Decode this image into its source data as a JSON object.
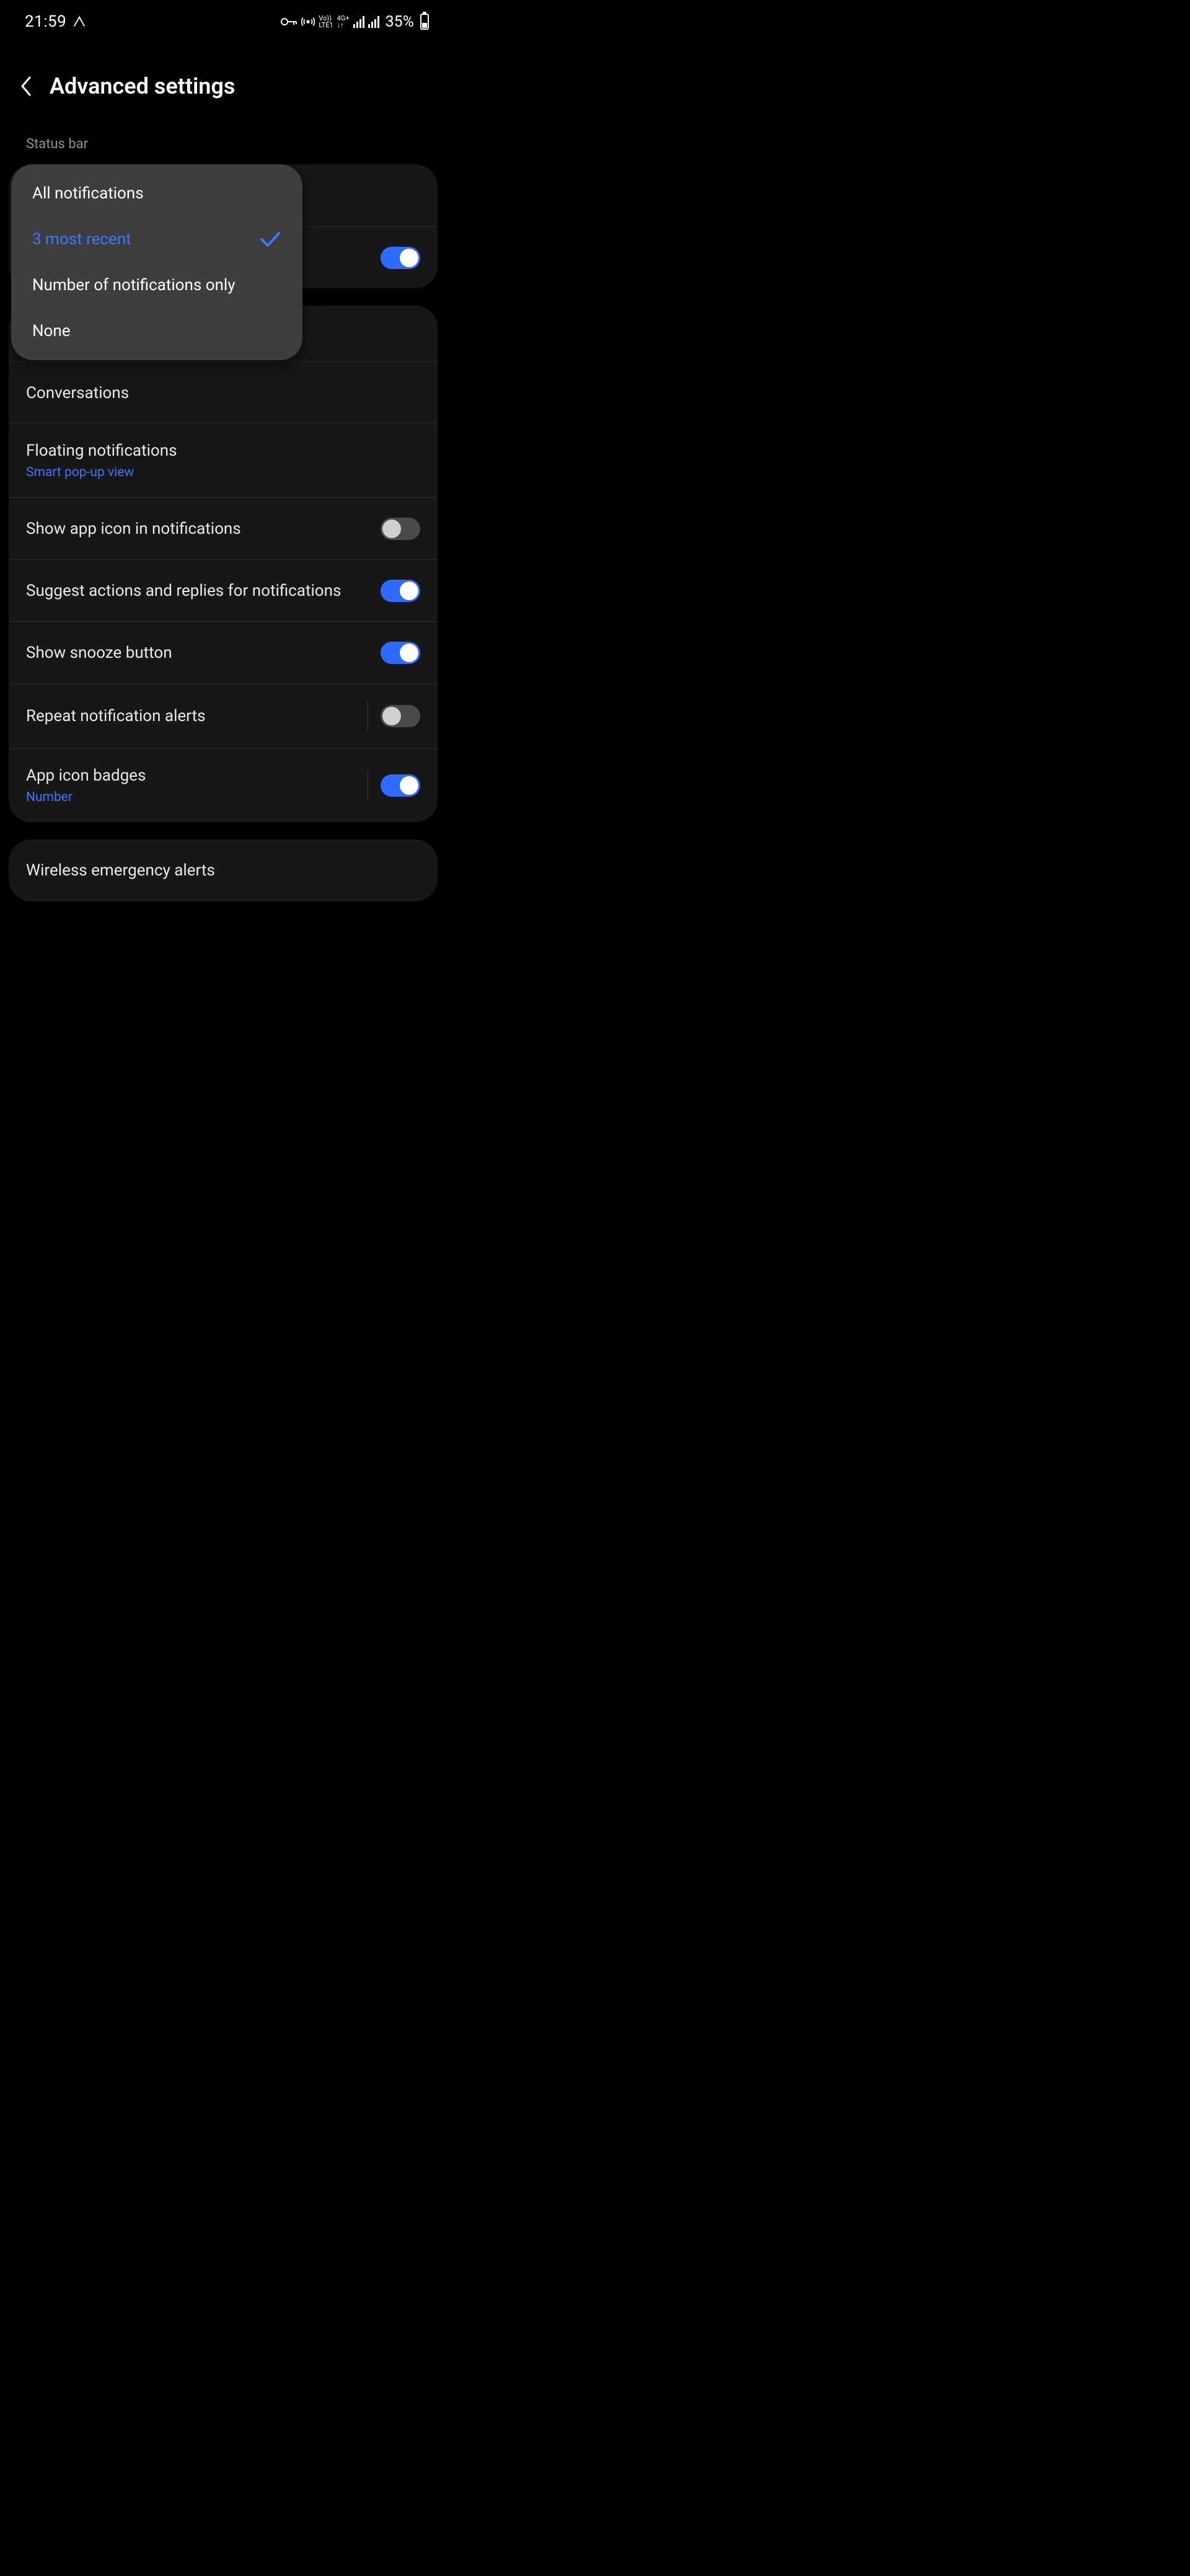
{
  "status": {
    "time": "21:59",
    "net_small_top": "Vo))",
    "net_small_bot": "LTE1",
    "net_4g_top": "4G+",
    "net_4g_bot": "↓↑",
    "battery": "35%"
  },
  "header": {
    "title": "Advanced settings"
  },
  "section_label": "Status bar",
  "popup": {
    "opt_all": "All notifications",
    "opt_3": "3 most recent",
    "opt_num": "Number of notifications only",
    "opt_none": "None"
  },
  "rows": {
    "conversations": "Conversations",
    "floating_title": "Floating notifications",
    "floating_sub": "Smart pop-up view",
    "app_icon": "Show app icon in notifications",
    "suggest": "Suggest actions and replies for notifications",
    "snooze": "Show snooze button",
    "repeat": "Repeat notification alerts",
    "badges_title": "App icon badges",
    "badges_sub": "Number",
    "wireless": "Wireless emergency alerts"
  }
}
